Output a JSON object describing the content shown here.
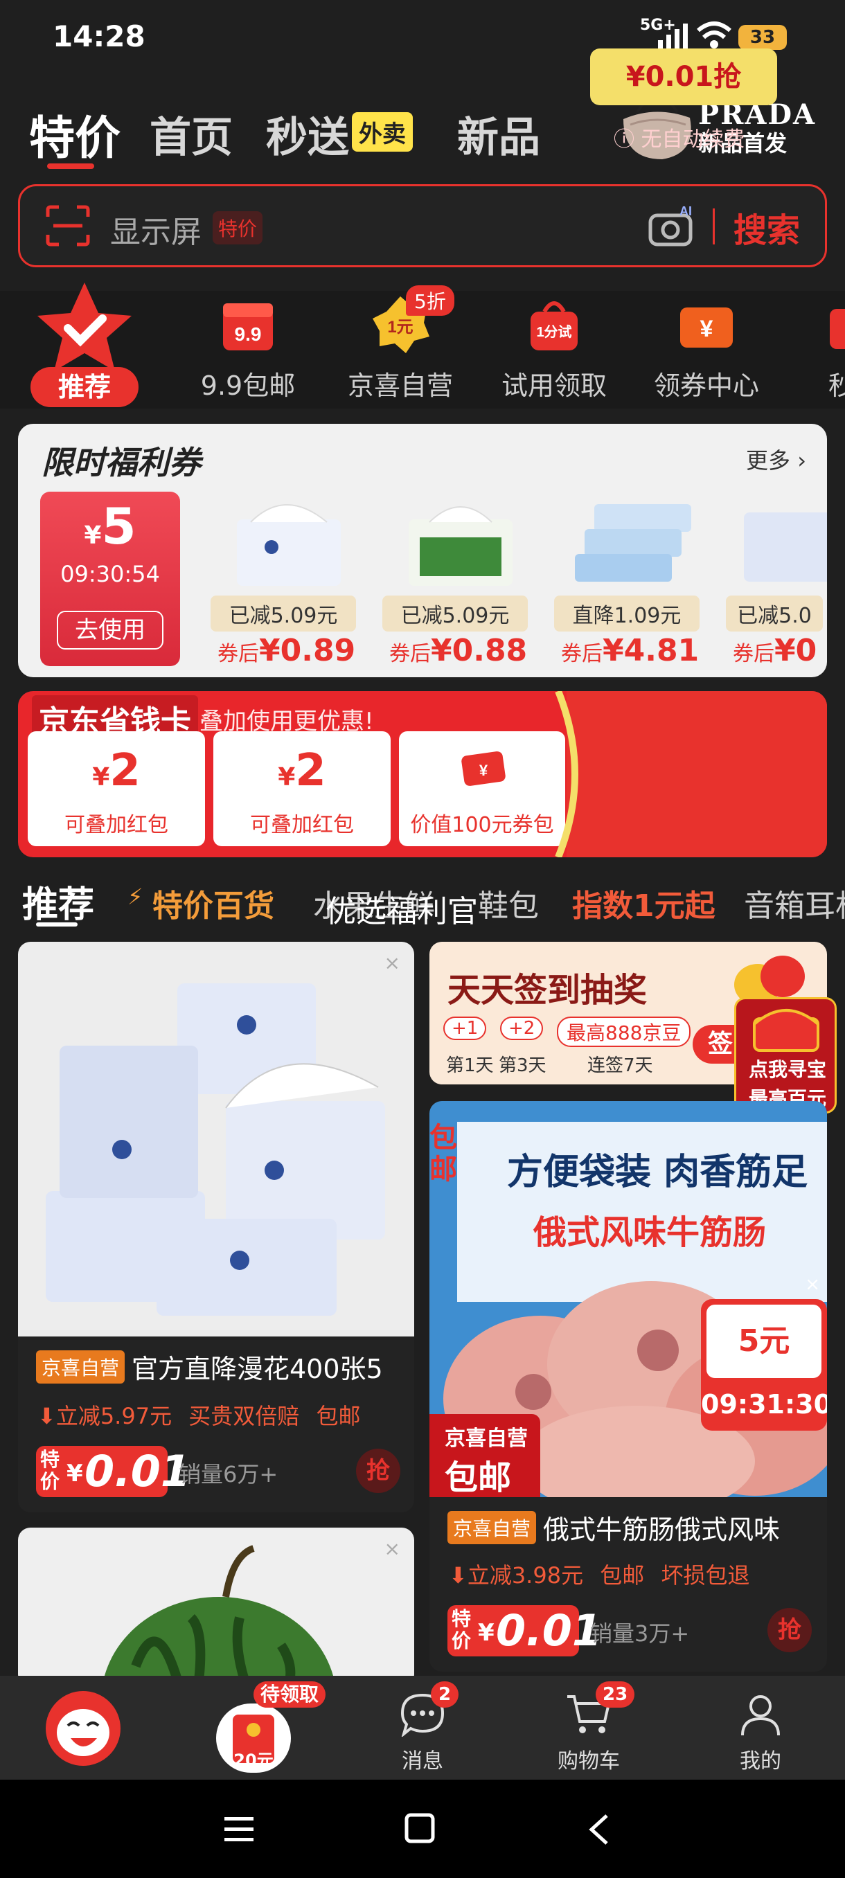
{
  "status_bar": {
    "time": "14:28",
    "network": "5G+",
    "battery": "33"
  },
  "top_tabs": [
    {
      "label": "特价",
      "active": true
    },
    {
      "label": "首页",
      "active": false
    },
    {
      "label": "秒送",
      "active": false,
      "badge": "外卖"
    },
    {
      "label": "新品",
      "active": false
    }
  ],
  "promo": {
    "brand": "PRADA",
    "subtitle": "新品首发"
  },
  "search": {
    "placeholder": "显示屏",
    "tag": "特价",
    "button": "搜索"
  },
  "categories": [
    {
      "label": "推荐",
      "icon": "check-star-icon",
      "active": true
    },
    {
      "label": "9.9包邮",
      "icon": "gift-9-9-icon",
      "icon_text": "9.9"
    },
    {
      "label": "京喜自营",
      "icon": "one-yuan-badge-icon",
      "icon_text": "1元",
      "badge": "5折"
    },
    {
      "label": "试用领取",
      "icon": "trial-bag-icon",
      "icon_text": "1分试"
    },
    {
      "label": "领券中心",
      "icon": "coupon-ticket-icon",
      "icon_text": "¥"
    },
    {
      "label": "秒",
      "icon": "partial-icon"
    }
  ],
  "coupon_section": {
    "title": "限时福利券",
    "more": "更多",
    "voucher": {
      "currency": "¥",
      "amount": "5",
      "countdown": "09:30:54",
      "button": "去使用"
    },
    "products": [
      {
        "tag": "已减5.09元",
        "price_prefix": "券后",
        "price": "¥0.89"
      },
      {
        "tag": "已减5.09元",
        "price_prefix": "券后",
        "price": "¥0.88"
      },
      {
        "tag": "直降1.09元",
        "price_prefix": "券后",
        "price": "¥4.81"
      },
      {
        "tag": "已减5.0",
        "price_prefix": "券后",
        "price": "¥0"
      }
    ]
  },
  "savings_card": {
    "title": "京东省钱卡",
    "subtitle": "叠加使用更优惠!",
    "boxes": [
      {
        "big": "2",
        "currency": "¥",
        "label": "可叠加红包"
      },
      {
        "big": "2",
        "currency": "¥",
        "label": "可叠加红包"
      },
      {
        "icon": "red-envelope-icon",
        "label": "价值100元券包"
      }
    ],
    "button": "¥0.01抢",
    "note": "无自动续费"
  },
  "feed_tabs": [
    {
      "label": "推荐",
      "active": true
    },
    {
      "label": "特价百货",
      "color": "#f39c3a"
    },
    {
      "label": "水果生鲜"
    },
    {
      "label": "优选福利官"
    },
    {
      "label": "鞋包"
    },
    {
      "label": "指数1元起",
      "color": "#f25b3a"
    },
    {
      "label": "音箱耳机"
    }
  ],
  "left_cards": [
    {
      "tag": "京喜自营",
      "title": "官方直降漫花400张5",
      "discount": "立减5.97元",
      "extra1": "买贵双倍赔",
      "extra2": "包邮",
      "price_label": "特价",
      "currency": "¥",
      "price": "0.01",
      "sales": "销量6万+",
      "grab": "抢"
    }
  ],
  "right_banner": {
    "title": "天天签到抽奖",
    "chips": [
      "+1",
      "+2",
      "最高888京豆"
    ],
    "days": [
      "第1天",
      "第3天",
      "连签7天"
    ],
    "button": "签",
    "float_line1": "点我寻宝",
    "float_line2": "最高百元"
  },
  "right_card": {
    "image_text1": "方便袋装 肉香筋足",
    "image_text2": "俄式风味牛筋肠",
    "side_badge": "包邮",
    "corner_tag_line1": "京喜自营",
    "corner_tag_line2": "包邮",
    "timer_price": "5元",
    "timer_time": "09:31:30",
    "tag": "京喜自营",
    "title": "俄式牛筋肠俄式风味",
    "discount": "立减3.98元",
    "extra1": "包邮",
    "extra2": "坏损包退",
    "price_label": "特价",
    "currency": "¥",
    "price": "0.01",
    "sales": "销量3万+",
    "grab": "抢"
  },
  "bottom_nav": {
    "pending_badge": "待领取",
    "pending_value": "20元",
    "messages": {
      "label": "消息",
      "count": "2"
    },
    "cart": {
      "label": "购物车",
      "count": "23"
    },
    "me": {
      "label": "我的"
    }
  },
  "colors": {
    "accent": "#e8322d",
    "background": "#1f1f1f",
    "gold": "#f4df6a"
  }
}
